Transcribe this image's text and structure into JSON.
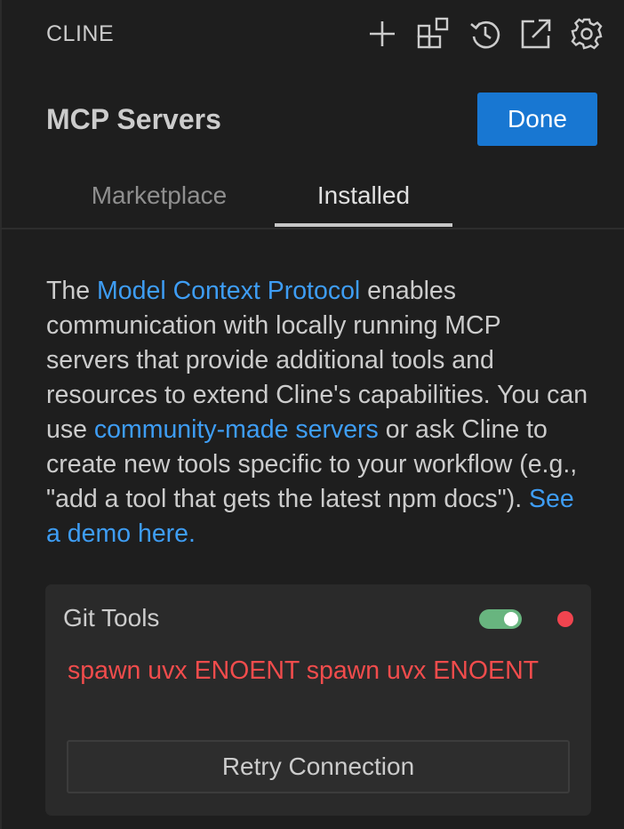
{
  "header": {
    "app_title": "CLINE",
    "icons": [
      "plus-icon",
      "extensions-icon",
      "history-icon",
      "open-external-icon",
      "gear-icon"
    ]
  },
  "view": {
    "title": "MCP Servers",
    "done_label": "Done"
  },
  "tabs": [
    {
      "label": "Marketplace",
      "active": false
    },
    {
      "label": "Installed",
      "active": true
    }
  ],
  "description": {
    "part1": "The ",
    "link1": "Model Context Protocol",
    "part2": " enables communication with locally running MCP servers that provide additional tools and resources to extend Cline's capabilities. You can use ",
    "link2": "community-made servers",
    "part3": " or ask Cline to create new tools specific to your workflow (e.g., \"add a tool that gets the latest npm docs\"). ",
    "link3": "See a demo here."
  },
  "server": {
    "name": "Git Tools",
    "enabled": true,
    "status": "error",
    "error": "spawn uvx ENOENT spawn uvx ENOENT",
    "retry_label": "Retry Connection"
  },
  "colors": {
    "background": "#1e1e1e",
    "accent": "#1877d2",
    "link": "#3e9df4",
    "error": "#f14c4c",
    "toggle_on": "#68b57f",
    "status_error": "#f1444f"
  }
}
